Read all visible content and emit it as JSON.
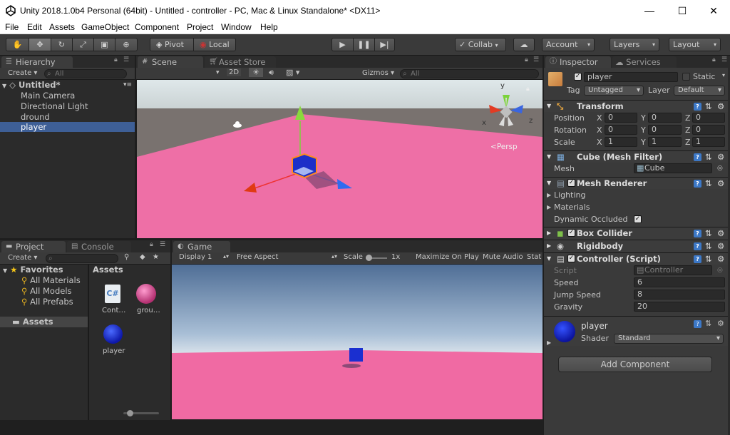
{
  "window": {
    "title": "Unity 2018.1.0b4 Personal (64bit) - Untitled - controller - PC, Mac & Linux Standalone* <DX11>",
    "minimize": "—",
    "maximize": "☐",
    "close": "✕"
  },
  "menu": [
    "File",
    "Edit",
    "Assets",
    "GameObject",
    "Component",
    "Project",
    "Window",
    "Help"
  ],
  "toolbar": {
    "pivot": "Pivot",
    "local": "Local",
    "collab": "Collab",
    "account": "Account",
    "layers": "Layers",
    "layout": "Layout"
  },
  "hierarchy": {
    "tab": "Hierarchy",
    "create": "Create",
    "search_placeholder": "All",
    "scene": "Untitled*",
    "items": [
      "Main Camera",
      "Directional Light",
      "dround",
      "player"
    ],
    "selected": "player"
  },
  "scene_view": {
    "tab_scene": "Scene",
    "tab_store": "Asset Store",
    "mode_2d": "2D",
    "gizmos": "Gizmos",
    "search_placeholder": "All",
    "persp": "Persp",
    "gizmo_x": "x",
    "gizmo_z": "z",
    "gizmo_y": "y"
  },
  "project": {
    "tab_project": "Project",
    "tab_console": "Console",
    "create": "Create",
    "favorites": "Favorites",
    "fav_items": [
      "All Materials",
      "All Models",
      "All Prefabs"
    ],
    "assets_root": "Assets",
    "assets_header": "Assets",
    "assets": [
      {
        "label": "Cont…",
        "kind": "script",
        "glyph": "C#"
      },
      {
        "label": "grou…",
        "kind": "material"
      },
      {
        "label": "player",
        "kind": "material-blue"
      }
    ]
  },
  "game_view": {
    "tab": "Game",
    "display": "Display 1",
    "aspect": "Free Aspect",
    "scale_label": "Scale",
    "scale_value": "1x",
    "maximize": "Maximize On Play",
    "mute": "Mute Audio",
    "stats": "Stat"
  },
  "inspector": {
    "tab": "Inspector",
    "tab_services": "Services",
    "object_name": "player",
    "static_label": "Static",
    "tag_label": "Tag",
    "tag_value": "Untagged",
    "layer_label": "Layer",
    "layer_value": "Default",
    "transform": {
      "title": "Transform",
      "position": {
        "label": "Position",
        "x": "0",
        "y": "0",
        "z": "0"
      },
      "rotation": {
        "label": "Rotation",
        "x": "0",
        "y": "0",
        "z": "0"
      },
      "scale": {
        "label": "Scale",
        "x": "1",
        "y": "1",
        "z": "1"
      }
    },
    "mesh_filter": {
      "title": "Cube (Mesh Filter)",
      "mesh_label": "Mesh",
      "mesh_value": "Cube"
    },
    "mesh_renderer": {
      "title": "Mesh Renderer",
      "lighting": "Lighting",
      "materials": "Materials",
      "dynamic": "Dynamic Occluded"
    },
    "box_collider": {
      "title": "Box Collider"
    },
    "rigidbody": {
      "title": "Rigidbody"
    },
    "controller": {
      "title": "Controller (Script)",
      "script_label": "Script",
      "script_value": "Controller",
      "speed_label": "Speed",
      "speed": "6",
      "jump_label": "Jump Speed",
      "jump": "8",
      "gravity_label": "Gravity",
      "gravity": "20"
    },
    "material": {
      "name": "player",
      "shader_label": "Shader",
      "shader_value": "Standard"
    },
    "add_component": "Add Component"
  },
  "colors": {
    "ground": "#f06aa3",
    "player": "#1a2fd0",
    "editor_bg": "#2b2b2b"
  }
}
